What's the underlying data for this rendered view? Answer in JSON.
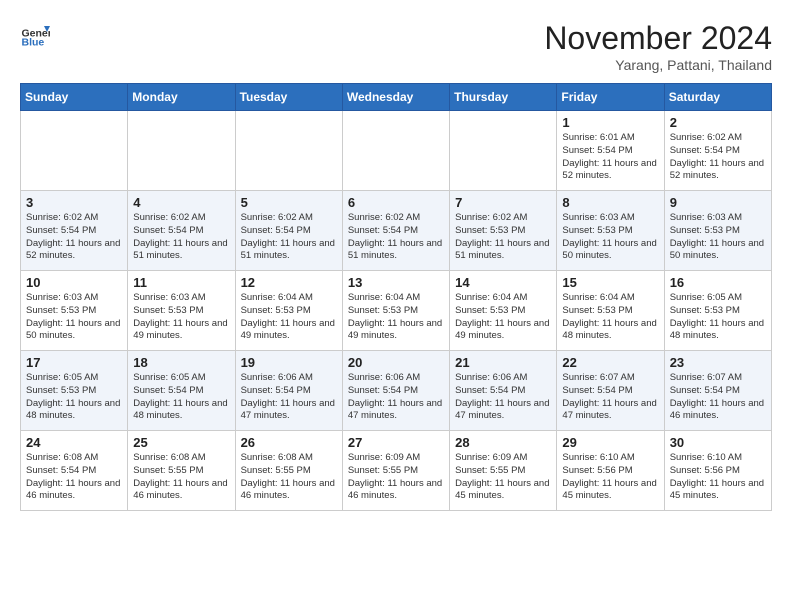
{
  "logo": {
    "general": "General",
    "blue": "Blue"
  },
  "title": "November 2024",
  "location": "Yarang, Pattani, Thailand",
  "days_header": [
    "Sunday",
    "Monday",
    "Tuesday",
    "Wednesday",
    "Thursday",
    "Friday",
    "Saturday"
  ],
  "weeks": [
    [
      {
        "day": "",
        "info": ""
      },
      {
        "day": "",
        "info": ""
      },
      {
        "day": "",
        "info": ""
      },
      {
        "day": "",
        "info": ""
      },
      {
        "day": "",
        "info": ""
      },
      {
        "day": "1",
        "info": "Sunrise: 6:01 AM\nSunset: 5:54 PM\nDaylight: 11 hours and 52 minutes."
      },
      {
        "day": "2",
        "info": "Sunrise: 6:02 AM\nSunset: 5:54 PM\nDaylight: 11 hours and 52 minutes."
      }
    ],
    [
      {
        "day": "3",
        "info": "Sunrise: 6:02 AM\nSunset: 5:54 PM\nDaylight: 11 hours and 52 minutes."
      },
      {
        "day": "4",
        "info": "Sunrise: 6:02 AM\nSunset: 5:54 PM\nDaylight: 11 hours and 51 minutes."
      },
      {
        "day": "5",
        "info": "Sunrise: 6:02 AM\nSunset: 5:54 PM\nDaylight: 11 hours and 51 minutes."
      },
      {
        "day": "6",
        "info": "Sunrise: 6:02 AM\nSunset: 5:54 PM\nDaylight: 11 hours and 51 minutes."
      },
      {
        "day": "7",
        "info": "Sunrise: 6:02 AM\nSunset: 5:53 PM\nDaylight: 11 hours and 51 minutes."
      },
      {
        "day": "8",
        "info": "Sunrise: 6:03 AM\nSunset: 5:53 PM\nDaylight: 11 hours and 50 minutes."
      },
      {
        "day": "9",
        "info": "Sunrise: 6:03 AM\nSunset: 5:53 PM\nDaylight: 11 hours and 50 minutes."
      }
    ],
    [
      {
        "day": "10",
        "info": "Sunrise: 6:03 AM\nSunset: 5:53 PM\nDaylight: 11 hours and 50 minutes."
      },
      {
        "day": "11",
        "info": "Sunrise: 6:03 AM\nSunset: 5:53 PM\nDaylight: 11 hours and 49 minutes."
      },
      {
        "day": "12",
        "info": "Sunrise: 6:04 AM\nSunset: 5:53 PM\nDaylight: 11 hours and 49 minutes."
      },
      {
        "day": "13",
        "info": "Sunrise: 6:04 AM\nSunset: 5:53 PM\nDaylight: 11 hours and 49 minutes."
      },
      {
        "day": "14",
        "info": "Sunrise: 6:04 AM\nSunset: 5:53 PM\nDaylight: 11 hours and 49 minutes."
      },
      {
        "day": "15",
        "info": "Sunrise: 6:04 AM\nSunset: 5:53 PM\nDaylight: 11 hours and 48 minutes."
      },
      {
        "day": "16",
        "info": "Sunrise: 6:05 AM\nSunset: 5:53 PM\nDaylight: 11 hours and 48 minutes."
      }
    ],
    [
      {
        "day": "17",
        "info": "Sunrise: 6:05 AM\nSunset: 5:53 PM\nDaylight: 11 hours and 48 minutes."
      },
      {
        "day": "18",
        "info": "Sunrise: 6:05 AM\nSunset: 5:54 PM\nDaylight: 11 hours and 48 minutes."
      },
      {
        "day": "19",
        "info": "Sunrise: 6:06 AM\nSunset: 5:54 PM\nDaylight: 11 hours and 47 minutes."
      },
      {
        "day": "20",
        "info": "Sunrise: 6:06 AM\nSunset: 5:54 PM\nDaylight: 11 hours and 47 minutes."
      },
      {
        "day": "21",
        "info": "Sunrise: 6:06 AM\nSunset: 5:54 PM\nDaylight: 11 hours and 47 minutes."
      },
      {
        "day": "22",
        "info": "Sunrise: 6:07 AM\nSunset: 5:54 PM\nDaylight: 11 hours and 47 minutes."
      },
      {
        "day": "23",
        "info": "Sunrise: 6:07 AM\nSunset: 5:54 PM\nDaylight: 11 hours and 46 minutes."
      }
    ],
    [
      {
        "day": "24",
        "info": "Sunrise: 6:08 AM\nSunset: 5:54 PM\nDaylight: 11 hours and 46 minutes."
      },
      {
        "day": "25",
        "info": "Sunrise: 6:08 AM\nSunset: 5:55 PM\nDaylight: 11 hours and 46 minutes."
      },
      {
        "day": "26",
        "info": "Sunrise: 6:08 AM\nSunset: 5:55 PM\nDaylight: 11 hours and 46 minutes."
      },
      {
        "day": "27",
        "info": "Sunrise: 6:09 AM\nSunset: 5:55 PM\nDaylight: 11 hours and 46 minutes."
      },
      {
        "day": "28",
        "info": "Sunrise: 6:09 AM\nSunset: 5:55 PM\nDaylight: 11 hours and 45 minutes."
      },
      {
        "day": "29",
        "info": "Sunrise: 6:10 AM\nSunset: 5:56 PM\nDaylight: 11 hours and 45 minutes."
      },
      {
        "day": "30",
        "info": "Sunrise: 6:10 AM\nSunset: 5:56 PM\nDaylight: 11 hours and 45 minutes."
      }
    ]
  ]
}
